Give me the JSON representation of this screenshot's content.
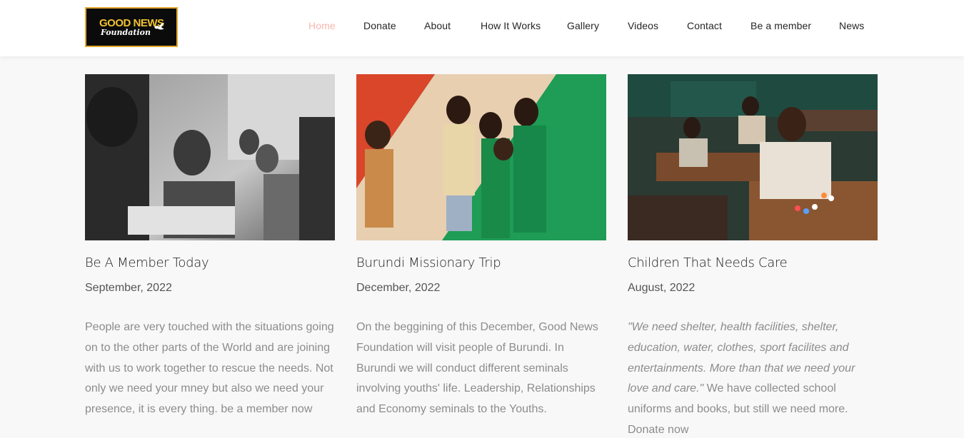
{
  "header": {
    "logo": {
      "line1": "GOOD NEWS",
      "line2": "Foundation"
    },
    "nav": [
      {
        "label": "Home",
        "active": true
      },
      {
        "label": "Donate",
        "active": false
      },
      {
        "label": "About",
        "active": false
      },
      {
        "label": "How It Works",
        "active": false
      },
      {
        "label": "Gallery",
        "active": false
      },
      {
        "label": "Videos",
        "active": false
      },
      {
        "label": "Contact",
        "active": false
      },
      {
        "label": "Be a member",
        "active": false
      },
      {
        "label": "News",
        "active": false
      }
    ]
  },
  "cards": [
    {
      "image_desc": "grayscale-classroom-children",
      "title": "Be A Member Today",
      "date": "September, 2022",
      "body_italic": "",
      "body": "People are very touched with the situations going on to the other parts of the World and are joining with us to work together to rescue the needs. Not only we need your mney but also we need your presence, it is every thing. be a member now"
    },
    {
      "image_desc": "children-group-tricolor",
      "title": "Burundi Missionary Trip",
      "date": "December, 2022",
      "body_italic": "",
      "body": "On the beggining of this December, Good News Foundation will visit people of Burundi. In Burundi we will conduct different seminals involving youths' life. Leadership, Relationships and Economy seminals to the Youths."
    },
    {
      "image_desc": "classroom-desks-children",
      "title": "Children That Needs Care",
      "date": "August, 2022",
      "body_italic": "\"We need shelter, health facilities, shelter, education, water, clothes, sport facilites and entertainments. More than that we need your love and care.\"",
      "body": " We have collected school uniforms and books, but still we need more. Donate now"
    }
  ],
  "colors": {
    "nav_active": "#f7b6b0",
    "logo_border": "#e2a72e",
    "logo_text": "#f1c232"
  }
}
